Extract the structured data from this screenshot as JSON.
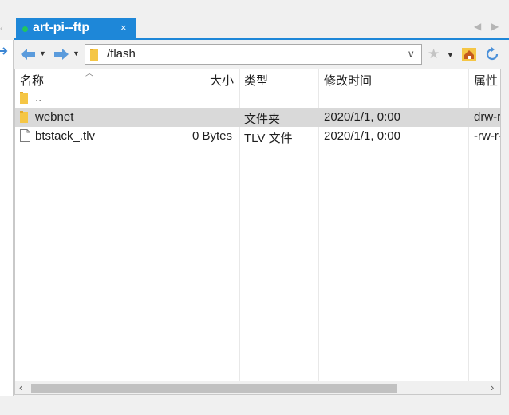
{
  "tab": {
    "title": "art-pi--ftp",
    "close": "×"
  },
  "toolbar": {
    "path": "/flash",
    "back_icon": "arrow-left-icon",
    "forward_icon": "arrow-right-icon"
  },
  "columns": {
    "name": "名称",
    "size": "大小",
    "type": "类型",
    "modified": "修改时间",
    "attributes": "属性"
  },
  "files": [
    {
      "name": "..",
      "size": "",
      "type": "",
      "modified": "",
      "attributes": "",
      "icon": "folder-icon"
    },
    {
      "name": "webnet",
      "size": "",
      "type": "文件夹",
      "modified": "2020/1/1, 0:00",
      "attributes": "drw-r",
      "icon": "folder-icon",
      "selected": true
    },
    {
      "name": "btstack_.tlv",
      "size": "0 Bytes",
      "type": "TLV 文件",
      "modified": "2020/1/1, 0:00",
      "attributes": "-rw-r-",
      "icon": "file-icon"
    }
  ],
  "colors": {
    "accent": "#1e87d8",
    "selected_row": "#d9d9d9",
    "folder": "#f5c645",
    "status_dot": "#22c55e"
  }
}
